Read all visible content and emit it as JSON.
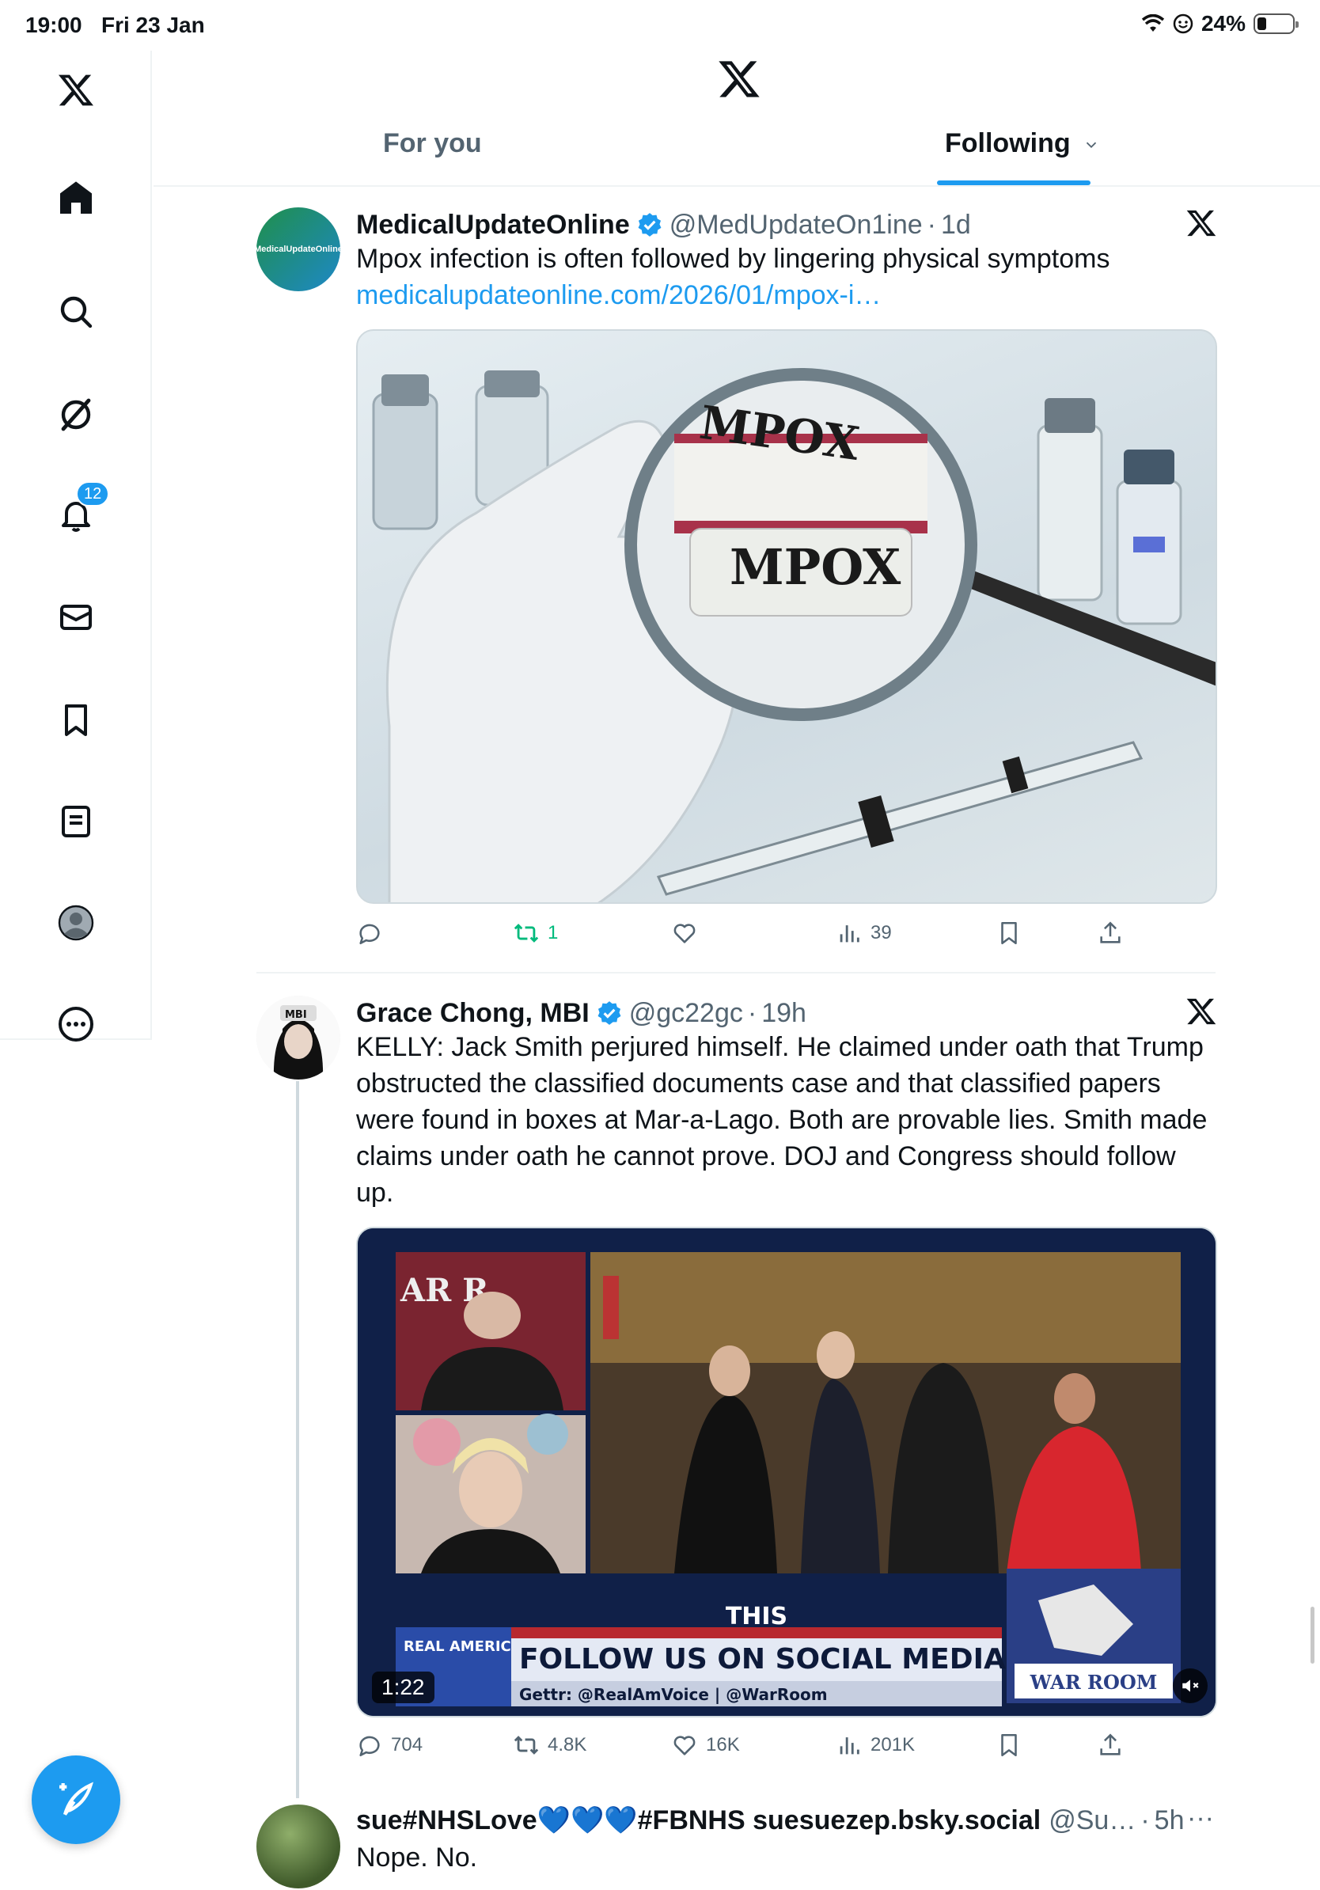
{
  "status_bar": {
    "time": "19:00",
    "date": "Fri 23 Jan",
    "battery": "24%",
    "battery_level": 0.24
  },
  "sidebar": {
    "items": [
      {
        "icon": "x-logo-icon"
      },
      {
        "icon": "home-icon"
      },
      {
        "icon": "search-icon"
      },
      {
        "icon": "grok-icon"
      },
      {
        "icon": "notifications-icon",
        "badge": "12"
      },
      {
        "icon": "messages-icon"
      },
      {
        "icon": "bookmarks-icon"
      },
      {
        "icon": "lists-icon"
      },
      {
        "icon": "profile-icon"
      },
      {
        "icon": "more-icon"
      }
    ],
    "compose_icon": "compose-post-icon"
  },
  "header": {
    "tabs": [
      {
        "label": "For you",
        "active": false
      },
      {
        "label": "Following",
        "active": true
      }
    ]
  },
  "posts": [
    {
      "name": "MedicalUpdateOnline",
      "handle": "@MedUpdateOn1ine",
      "sep": "·",
      "time": "1d",
      "text": "Mpox infection is often followed by lingering physical symptoms",
      "link": "medicalupdateonline.com/2026/01/mpox-i…",
      "avatar_text": "MedicalUpdateOnline",
      "media_text_1": "MPOX",
      "media_text_2": "MPOX",
      "stats": {
        "replies": "",
        "reposts": "1",
        "likes": "",
        "views": "39"
      }
    },
    {
      "name": "Grace Chong, MBI",
      "handle": "@gc22gc",
      "sep": "·",
      "time": "19h",
      "avatar_text": "MBI",
      "text": "KELLY: Jack Smith perjured himself. He claimed under oath that Trump obstructed the classified documents case and that classified papers were found in boxes at Mar-a-Lago. Both are provable lies. Smith made claims under oath he cannot prove. DOJ and Congress should follow up.",
      "video": {
        "duration": "1:22",
        "banner_top": "THIS",
        "banner_main": "FOLLOW US ON SOCIAL MEDIA",
        "banner_sub": "Gettr: @RealAmVoice | @WarRoom",
        "network": "REAL AMERICA'S VOICE",
        "show": "WAR ROOM",
        "corner_text": "AR R"
      },
      "stats": {
        "replies": "704",
        "reposts": "4.8K",
        "likes": "16K",
        "views": "201K"
      }
    },
    {
      "name": "sue#NHSLove💙💙💙#FBNHS suesuezep.bsky.social",
      "handle": "@Su…",
      "sep": "·",
      "time": "5h",
      "text": "Nope. No."
    }
  ],
  "colors": {
    "accent": "#1d9bf0",
    "repost_active": "#00ba7c",
    "muted": "#536471"
  }
}
